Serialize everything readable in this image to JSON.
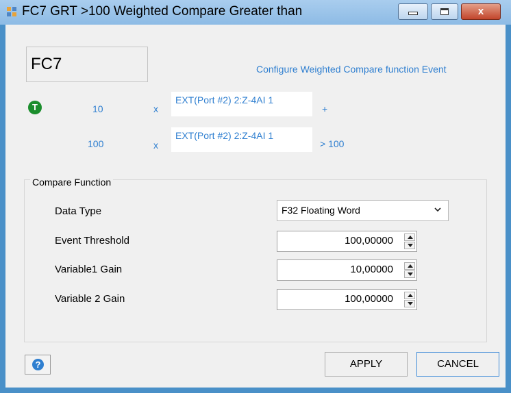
{
  "window": {
    "title": "FC7 GRT >100 Weighted Compare Greater than",
    "close_glyph": "x"
  },
  "header": {
    "function_id": "FC7",
    "config_label": "Configure Weighted Compare function Event"
  },
  "rows": [
    {
      "icon": "T",
      "gain": "10",
      "multiply": "x",
      "source": "EXT(Port #2) 2:Z-4AI 1",
      "operator": "+"
    },
    {
      "gain": "100",
      "multiply": "x",
      "source": "EXT(Port #2) 2:Z-4AI 1",
      "operator": "> 100"
    }
  ],
  "compare_function": {
    "title": "Compare Function",
    "data_type_label": "Data Type",
    "data_type_value": "F32 Floating Word",
    "threshold_label": "Event Threshold",
    "threshold_value": "100,00000",
    "gain1_label": "Variable1 Gain",
    "gain1_value": "10,00000",
    "gain2_label": "Variable 2 Gain",
    "gain2_value": "100,00000"
  },
  "footer": {
    "help_icon": "?",
    "apply_label": "APPLY",
    "cancel_label": "CANCEL"
  },
  "colors": {
    "accent": "#2f7fd0",
    "status_green": "#1b8e2d",
    "close_red": "#c2452b"
  }
}
